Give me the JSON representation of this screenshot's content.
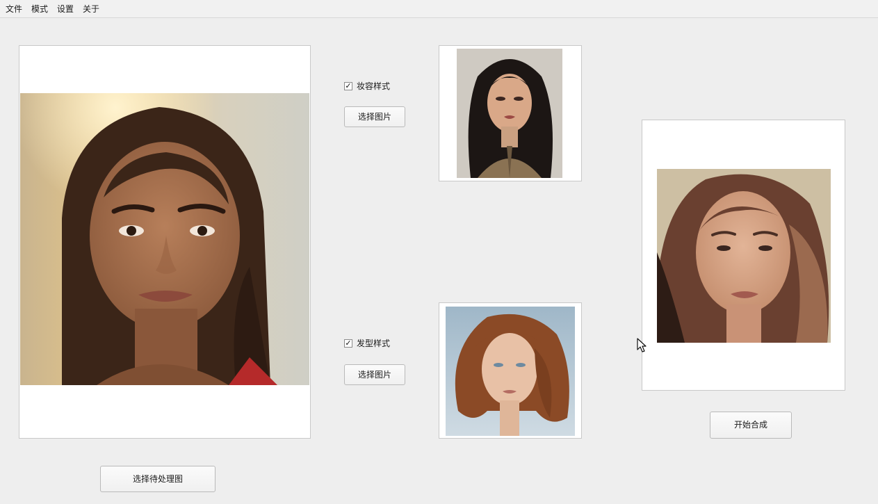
{
  "menubar": {
    "items": [
      {
        "label": "文件"
      },
      {
        "label": "模式"
      },
      {
        "label": "设置"
      },
      {
        "label": "关于"
      }
    ]
  },
  "makeup": {
    "checkbox_label": "妆容样式",
    "checked": true,
    "select_button_label": "选择图片"
  },
  "hairstyle": {
    "checkbox_label": "发型样式",
    "checked": true,
    "select_button_label": "选择图片"
  },
  "source": {
    "select_button_label": "选择待处理图"
  },
  "result": {
    "start_button_label": "开始合成"
  },
  "colors": {
    "window_bg": "#eeeeee",
    "panel_bg": "#ffffff",
    "panel_border": "#c8c8c8",
    "button_border": "#b9b9b9"
  }
}
